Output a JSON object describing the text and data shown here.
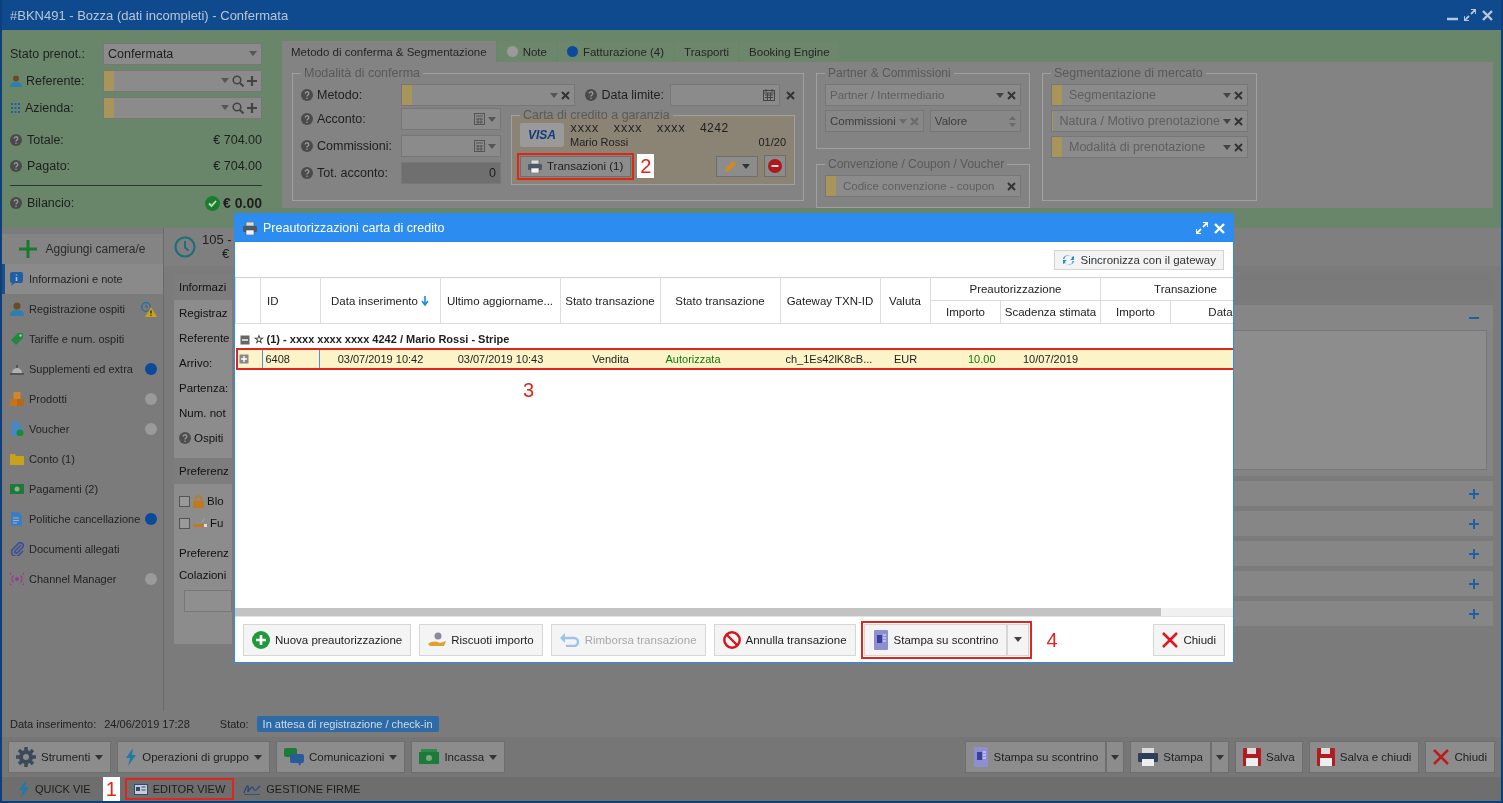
{
  "window": {
    "title": "#BKN491 - Bozza (dati incompleti) - Confermata"
  },
  "booking": {
    "fields": [
      {
        "kind": "select",
        "label": "Stato prenot.:",
        "value": "Confermata"
      },
      {
        "kind": "lookup",
        "label": "Referente:"
      },
      {
        "kind": "lookup",
        "label": "Azienda:"
      }
    ],
    "totals": [
      {
        "label": "Totale:",
        "value": "€ 704.00"
      },
      {
        "label": "Pagato:",
        "value": "€ 704.00"
      }
    ],
    "balance": {
      "label": "Bilancio:",
      "value": "€ 0.00",
      "ok": true
    }
  },
  "tabs": [
    {
      "label": "Metodo di conferma & Segmentazione",
      "selected": true
    },
    {
      "label": "Note",
      "selected": false,
      "color": "#9a9a9a"
    },
    {
      "label": "Fatturazione (4)",
      "selected": false,
      "color": "#0b4a9a"
    },
    {
      "label": "Trasporti",
      "selected": false
    },
    {
      "label": "Booking Engine",
      "selected": false
    }
  ],
  "conferma": {
    "legend": "Modalità di conferma",
    "metodo": "Metodo:",
    "data_limite": "Data limite:",
    "acconto": "Acconto:",
    "commissioni": "Commissioni:",
    "tot_acconto": {
      "label": "Tot. acconto:",
      "value": "0"
    }
  },
  "carta": {
    "legend": "Carta di credito a garanzia",
    "brand": "VISA",
    "number": "xxxx  xxxx  xxxx  4242",
    "holder": "Mario Rossi",
    "expiry": "01/20",
    "button": {
      "label": "Transazioni (1)",
      "callout": "2"
    }
  },
  "partner": {
    "legend": "Partner & Commissioni",
    "fields": [
      {
        "placeholder": "Partner / Intermediario",
        "disabled": false
      },
      {
        "placeholder": "Commissioni",
        "disabled": true
      }
    ],
    "valore": {
      "placeholder": "Valore",
      "disabled": true
    }
  },
  "convenzione": {
    "legend": "Convenzione / Coupon / Voucher",
    "placeholder": "Codice convenzione - coupon"
  },
  "segmentazione": {
    "legend": "Segmentazione di mercato",
    "fields": [
      {
        "placeholder": "Segmentazione"
      },
      {
        "placeholder": "Natura / Motivo prenotazione"
      },
      {
        "placeholder": "Modalità di prenotazione"
      }
    ]
  },
  "sidebar": {
    "add_button": "Aggiungi camera/e",
    "items": [
      {
        "label": "Informazioni e note",
        "selected": true
      },
      {
        "label": "Registrazione ospiti",
        "selected": false,
        "warning": true
      },
      {
        "label": "Tariffe e num. ospiti",
        "selected": false
      },
      {
        "label": "Supplementi ed extra",
        "selected": false,
        "color": "#0b4a9a"
      },
      {
        "label": "Prodotti",
        "selected": false,
        "color": "#9a9a9a"
      },
      {
        "label": "Voucher",
        "selected": false,
        "color": "#9a9a9a"
      },
      {
        "label": "Conto (1)",
        "selected": false
      },
      {
        "label": "Pagamenti (2)",
        "selected": false
      },
      {
        "label": "Politiche cancellazione",
        "selected": false,
        "color": "#0b4a9a"
      },
      {
        "label": "Documenti allegati",
        "selected": false
      },
      {
        "label": "Channel Manager",
        "selected": false,
        "color": "#9a9a9a"
      }
    ]
  },
  "room": {
    "number": "105 -",
    "price": "€"
  },
  "content": {
    "section_1": "Informazi",
    "lines": [
      "Registraz",
      "Referente",
      "Arrivo:",
      "Partenza:",
      "Num. not"
    ],
    "help_line": "Ospiti",
    "section_2": "Preferenz",
    "checks": [
      {
        "label": "Blo",
        "checked": false
      },
      {
        "label": "Fu",
        "checked": false
      }
    ],
    "lines_2": [
      "Preferenz",
      "Colazioni"
    ]
  },
  "right_panels": [
    {
      "expanded": true
    },
    {
      "expanded": false
    },
    {
      "expanded": false
    },
    {
      "expanded": false
    },
    {
      "expanded": false
    },
    {
      "expanded": false
    }
  ],
  "status": {
    "inserted_label": "Data inserimento:",
    "inserted_value": "24/06/2019 17:28",
    "state_label": "Stato:",
    "state_badge": "In attesa di registrazione / check-in"
  },
  "toolbar": {
    "left": [
      {
        "label": "Strumenti",
        "kind": "gear"
      },
      {
        "label": "Operazioni di gruppo",
        "kind": "bolt"
      },
      {
        "label": "Comunicazioni",
        "kind": "chat"
      },
      {
        "label": "Incassa",
        "kind": "money"
      }
    ],
    "right": [
      {
        "label": "Stampa su scontrino",
        "kind": "receipt",
        "split": true
      },
      {
        "label": "Stampa",
        "kind": "printer",
        "split": true
      },
      {
        "label": "Salva",
        "kind": "save",
        "split": false
      },
      {
        "label": "Salva e chiudi",
        "kind": "save",
        "split": false
      },
      {
        "label": "Chiudi",
        "kind": "close",
        "split": false
      }
    ]
  },
  "bottom_tabs": [
    {
      "label": "QUICK VIE",
      "kind": "bolt",
      "selected": false
    },
    {
      "label": "EDITOR VIEW",
      "kind": "card",
      "selected": false,
      "callout": "1"
    },
    {
      "label": "GESTIONE FIRME",
      "kind": "sign",
      "selected": false
    }
  ],
  "modal": {
    "title": "Preautorizzazioni carta di credito",
    "sync_button": "Sincronizza con il gateway",
    "columns": [
      {
        "label": "ID",
        "sorted": false
      },
      {
        "label": "Data inserimento",
        "sorted": true
      },
      {
        "label": "Ultimo aggiorname...",
        "sorted": false
      },
      {
        "label": "Stato transazione",
        "sorted": false
      },
      {
        "label": "Stato transazione",
        "sorted": false
      },
      {
        "label": "Gateway TXN-ID",
        "sorted": false
      },
      {
        "label": "Valuta",
        "sorted": false
      },
      {
        "label": "Importo",
        "sorted": false,
        "kind": "preauth"
      },
      {
        "label": "Scadenza stimata",
        "sorted": false,
        "kind": "preauth"
      },
      {
        "label": "Importo",
        "sorted": false,
        "kind": "transaction"
      },
      {
        "label": "Data",
        "sorted": false,
        "kind": "transaction"
      }
    ],
    "column_groups": [
      {
        "kind": "preauth",
        "label": "Preautorizzazione"
      },
      {
        "kind": "transaction",
        "label": "Transazione"
      }
    ],
    "group_row": {
      "label": "☆ (1) - xxxx xxxx xxxx 4242 / Mario Rossi - Stripe",
      "expanded": true
    },
    "rows": [
      {
        "selected": true,
        "expanded": false,
        "callout": "3",
        "cells": [
          {
            "text": "6408"
          },
          {
            "text": "03/07/2019 10:42"
          },
          {
            "text": "03/07/2019 10:43"
          },
          {
            "text": "Vendita"
          },
          {
            "text": "Autorizzata",
            "color": "#117a11"
          },
          {
            "text": "ch_1Es42lK8cB..."
          },
          {
            "text": "EUR"
          },
          {
            "text": "10.00",
            "color": "#117a11"
          },
          {
            "text": "10/07/2019"
          }
        ]
      }
    ],
    "buttons": [
      {
        "label": "Nuova preautorizzazione",
        "kind": "add",
        "disabled": false
      },
      {
        "label": "Riscuoti importo",
        "kind": "collect",
        "disabled": false
      },
      {
        "label": "Rimborsa transazione",
        "kind": "refund",
        "disabled": true
      },
      {
        "label": "Annulla transazione",
        "kind": "cancel",
        "disabled": false
      },
      {
        "label": "Stampa su scontrino",
        "kind": "receipt",
        "disabled": false,
        "split": true,
        "callout": "4"
      },
      {
        "label": "Chiudi",
        "kind": "close",
        "disabled": false
      }
    ]
  }
}
